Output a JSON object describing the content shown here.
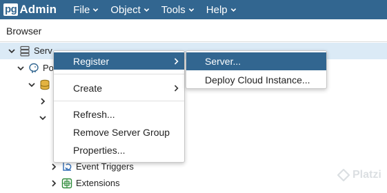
{
  "app": {
    "logo_prefix": "pg",
    "logo_suffix": "Admin"
  },
  "nav": {
    "items": [
      {
        "label": "File"
      },
      {
        "label": "Object"
      },
      {
        "label": "Tools"
      },
      {
        "label": "Help"
      }
    ]
  },
  "browser": {
    "title": "Browser"
  },
  "tree": {
    "nodes": [
      {
        "label": "Serv",
        "icon": "server-group-icon",
        "expanded": true,
        "selected": true
      },
      {
        "label": "Po",
        "icon": "postgres-elephant-icon",
        "expanded": true
      },
      {
        "label": "",
        "icon": "database-icon",
        "expanded": true
      },
      {
        "label": "",
        "expanded": false
      },
      {
        "label": "",
        "expanded": true
      },
      {
        "label": "Event Triggers",
        "icon": "event-trigger-icon",
        "expanded": false
      },
      {
        "label": "Extensions",
        "icon": "extension-icon",
        "expanded": false
      }
    ]
  },
  "context_menu": {
    "items": [
      {
        "label": "Register",
        "has_submenu": true,
        "active": true
      },
      {
        "label": "Create",
        "has_submenu": true
      },
      {
        "label": "Refresh..."
      },
      {
        "label": "Remove Server Group"
      },
      {
        "label": "Properties..."
      }
    ]
  },
  "sub_menu": {
    "items": [
      {
        "label": "Server...",
        "active": true
      },
      {
        "label": "Deploy Cloud Instance..."
      }
    ]
  },
  "watermark": {
    "label": "Platzi"
  },
  "colors": {
    "navbar": "#326690",
    "selection": "#dbeaf6",
    "menu_active": "#326690"
  }
}
